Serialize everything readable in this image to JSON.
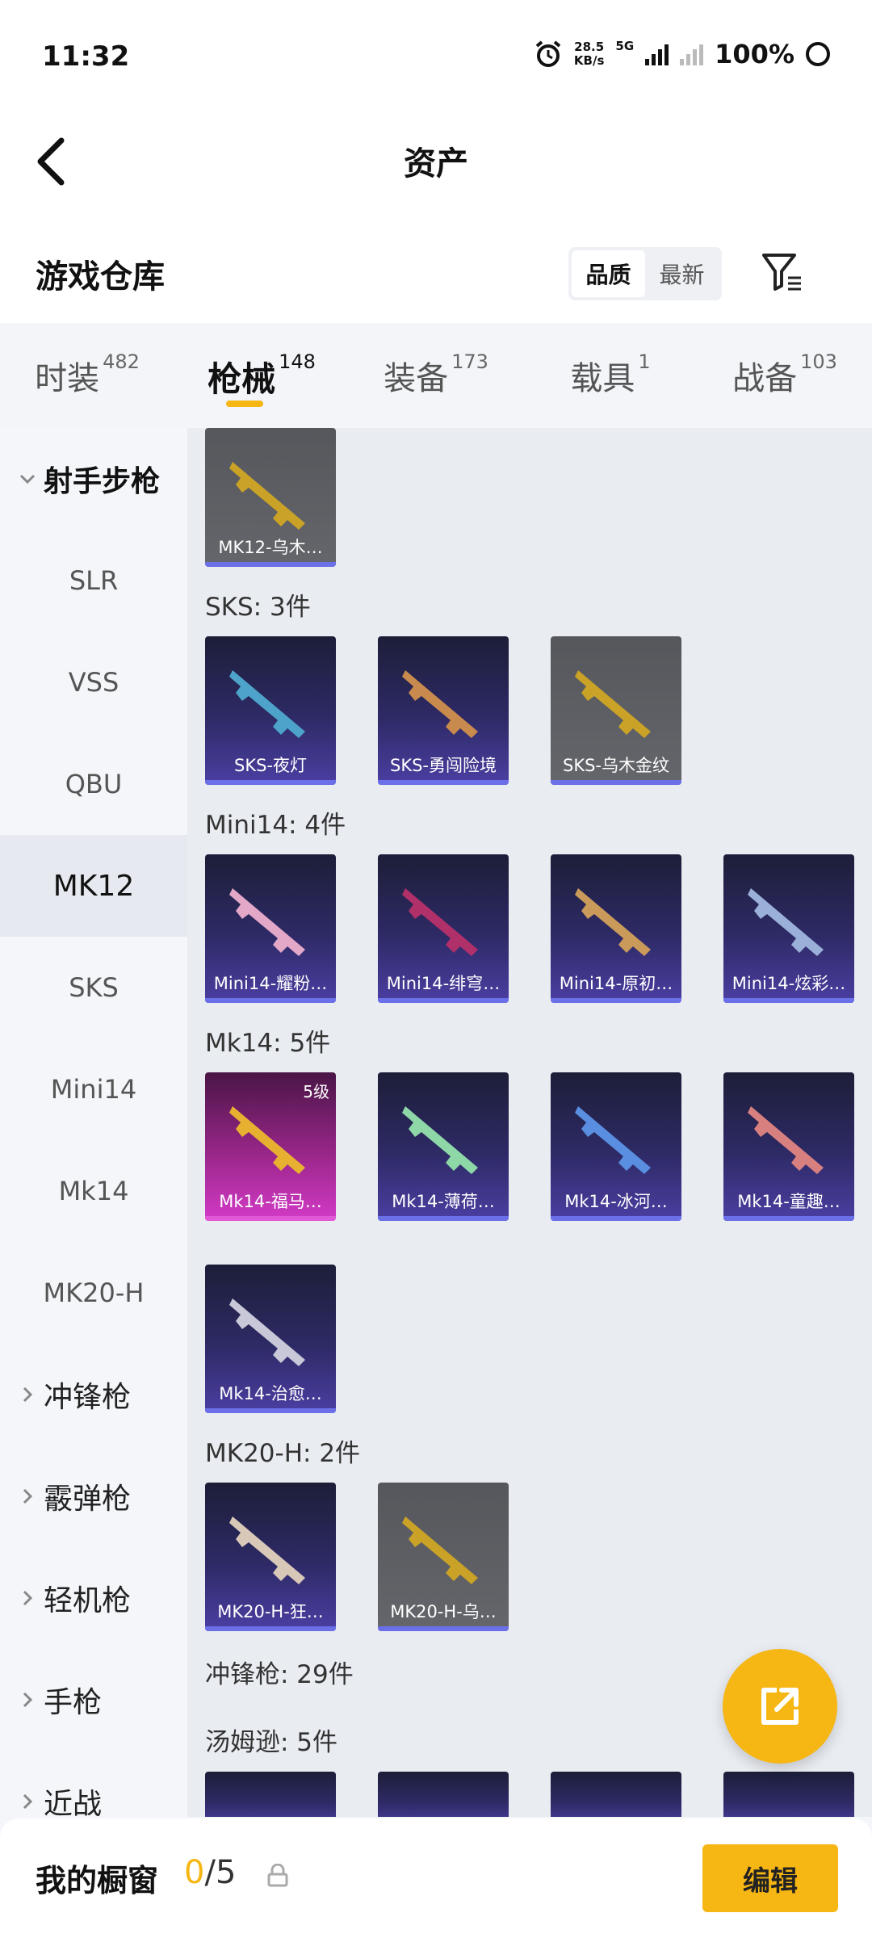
{
  "status_bar": {
    "time": "11:32",
    "net_speed_value": "28.5",
    "net_speed_unit": "KB/s",
    "network_type": "5G",
    "battery": "100%"
  },
  "header": {
    "title": "资产"
  },
  "section": {
    "title": "游戏仓库",
    "sort_options": [
      "品质",
      "最新"
    ],
    "sort_selected": "品质"
  },
  "tabs": [
    {
      "label": "时装",
      "count": "482",
      "active": false
    },
    {
      "label": "枪械",
      "count": "148",
      "active": true
    },
    {
      "label": "装备",
      "count": "173",
      "active": false
    },
    {
      "label": "载具",
      "count": "1",
      "active": false
    },
    {
      "label": "战备",
      "count": "103",
      "active": false
    }
  ],
  "sidebar": {
    "groups": [
      {
        "label": "射手步枪",
        "open": true
      },
      {
        "label": "冲锋枪",
        "open": false
      },
      {
        "label": "霰弹枪",
        "open": false
      },
      {
        "label": "轻机枪",
        "open": false
      },
      {
        "label": "手枪",
        "open": false
      },
      {
        "label": "近战",
        "open": false
      }
    ],
    "items": [
      "SLR",
      "VSS",
      "QBU",
      "MK12",
      "SKS",
      "Mini14",
      "Mk14",
      "MK20-H"
    ],
    "selected": "MK12"
  },
  "content": {
    "groups": [
      {
        "label": "",
        "items": [
          {
            "name": "MK12-乌木…",
            "rarity": "gray"
          }
        ]
      },
      {
        "label": "SKS: 3件",
        "items": [
          {
            "name": "SKS-夜灯",
            "rarity": "purple"
          },
          {
            "name": "SKS-勇闯险境",
            "rarity": "purple"
          },
          {
            "name": "SKS-乌木金纹",
            "rarity": "gray"
          }
        ]
      },
      {
        "label": "Mini14: 4件",
        "items": [
          {
            "name": "Mini14-耀粉…",
            "rarity": "purple"
          },
          {
            "name": "Mini14-绯穹…",
            "rarity": "purple"
          },
          {
            "name": "Mini14-原初…",
            "rarity": "purple"
          },
          {
            "name": "Mini14-炫彩…",
            "rarity": "purple"
          }
        ]
      },
      {
        "label": "Mk14: 5件",
        "items": [
          {
            "name": "Mk14-福马…",
            "rarity": "pink",
            "level": "5级"
          },
          {
            "name": "Mk14-薄荷…",
            "rarity": "purple"
          },
          {
            "name": "Mk14-冰河…",
            "rarity": "purple"
          },
          {
            "name": "Mk14-童趣…",
            "rarity": "purple"
          },
          {
            "name": "Mk14-治愈…",
            "rarity": "purple"
          }
        ]
      },
      {
        "label": "MK20-H: 2件",
        "items": [
          {
            "name": "MK20-H-狂…",
            "rarity": "purple"
          },
          {
            "name": "MK20-H-乌…",
            "rarity": "gray"
          }
        ]
      },
      {
        "label": "冲锋枪: 29件",
        "items": []
      },
      {
        "label": "汤姆逊: 5件",
        "items": []
      }
    ]
  },
  "bottom_bar": {
    "showcase_label": "我的橱窗",
    "showcase_current": "0",
    "showcase_separator": "/",
    "showcase_total": "5",
    "edit_label": "编辑"
  },
  "colors": {
    "accent": "#f6b614",
    "purple_card": "#2e2a66",
    "gray_card": "#5d5f64",
    "pink_card": "#a02890"
  }
}
